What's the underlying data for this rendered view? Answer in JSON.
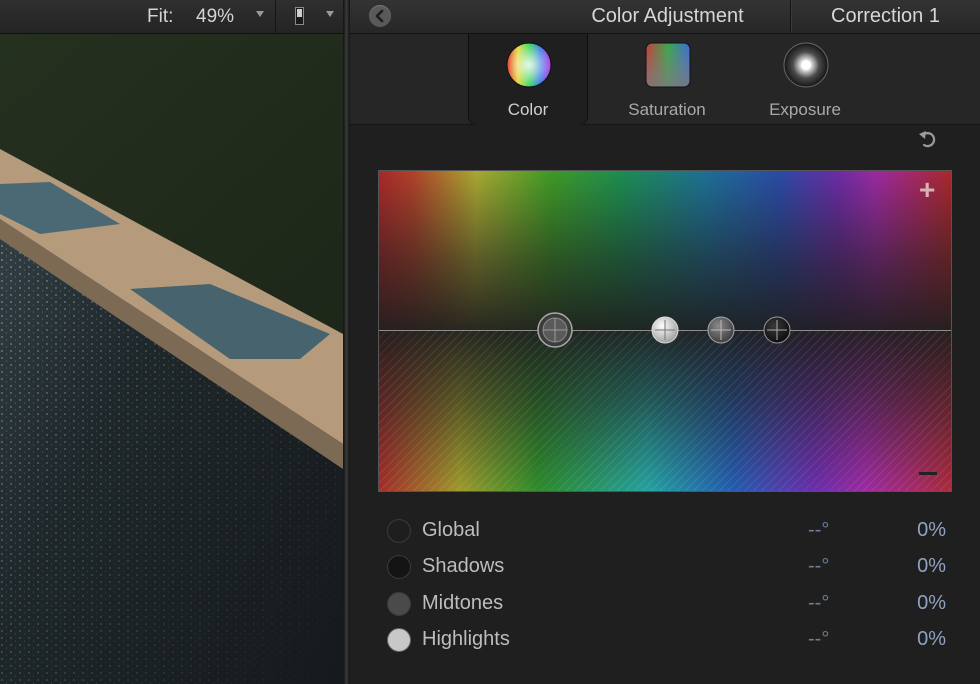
{
  "viewer": {
    "fit_label": "Fit:",
    "zoom": "49%"
  },
  "inspector": {
    "title": "Color Adjustment",
    "correction": "Correction 1",
    "tabs": [
      {
        "label": "Color",
        "icon": "color-wheel-icon",
        "selected": true
      },
      {
        "label": "Saturation",
        "icon": "saturation-swatch-icon",
        "selected": false
      },
      {
        "label": "Exposure",
        "icon": "exposure-sphere-icon",
        "selected": false
      }
    ],
    "ranges": [
      {
        "label": "Global",
        "angle": "--°",
        "percent": "0%",
        "dot_color": "#1e1e1e"
      },
      {
        "label": "Shadows",
        "angle": "--°",
        "percent": "0%",
        "dot_color": "#141414"
      },
      {
        "label": "Midtones",
        "angle": "--°",
        "percent": "0%",
        "dot_color": "#4a4a4a"
      },
      {
        "label": "Highlights",
        "angle": "--°",
        "percent": "0%",
        "dot_color": "#c8c8c8"
      }
    ]
  },
  "colors": {
    "panel_bg": "#1f1f1f",
    "value_text": "#8fa3c0"
  }
}
